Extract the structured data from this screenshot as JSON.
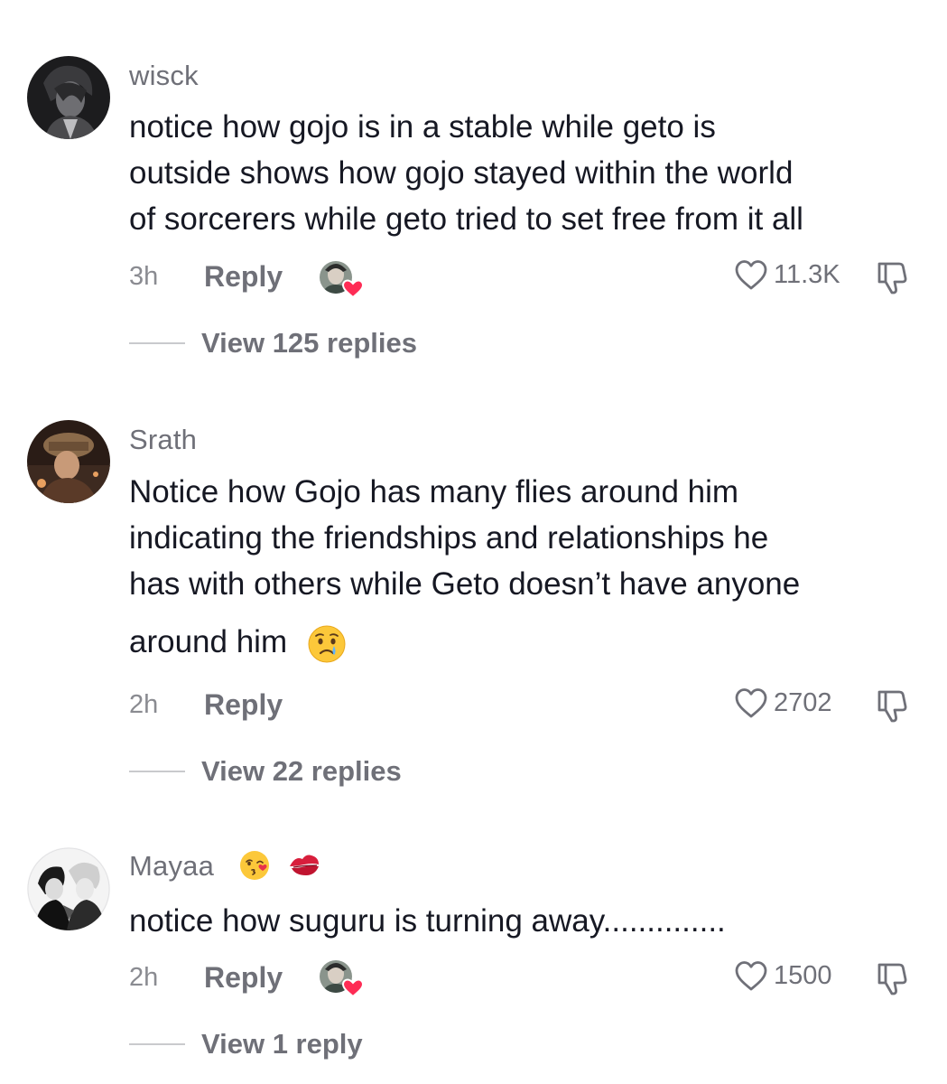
{
  "comments": [
    {
      "username": "wisck",
      "lines": [
        "notice how gojo is in a stable while geto is",
        "outside shows how gojo stayed within the world",
        "of sorcerers while geto tried to set free from it all"
      ],
      "time": "3h",
      "reply_label": "Reply",
      "creator_liked": true,
      "likes": "11.3K",
      "view_replies": "View 125 replies"
    },
    {
      "username": "Srath",
      "lines": [
        "Notice how Gojo has many flies around him",
        "indicating the friendships and relationships he",
        "has with others while Geto doesn’t have anyone",
        "around him"
      ],
      "emoji_after_text": "crying-face",
      "time": "2h",
      "reply_label": "Reply",
      "creator_liked": false,
      "likes": "2702",
      "view_replies": "View 22 replies"
    },
    {
      "username": "Mayaa",
      "username_emojis": [
        "kissing-face",
        "kiss-mark"
      ],
      "lines": [
        "notice how suguru is turning away.............."
      ],
      "time": "2h",
      "reply_label": "Reply",
      "creator_liked": true,
      "likes": "1500",
      "view_replies": "View 1 reply"
    }
  ],
  "colors": {
    "text": "#161823",
    "secondary": "#6f7078",
    "heart_badge": "#fe2c55"
  },
  "icons": {
    "like": "heart-outline-icon",
    "dislike": "thumbs-down-icon",
    "creator_liked_badge": "heart-badge-icon"
  }
}
